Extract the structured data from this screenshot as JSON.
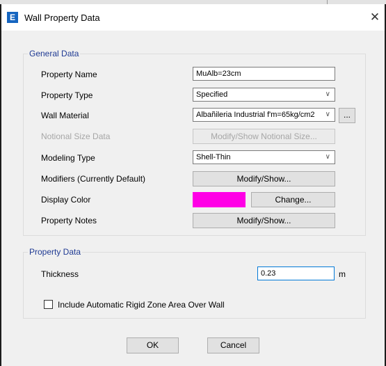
{
  "window": {
    "title": "Wall Property Data",
    "app_icon": "E",
    "close_glyph": "✕"
  },
  "general_data": {
    "title": "General Data",
    "property_name": {
      "label": "Property Name",
      "value": "MuAlb=23cm"
    },
    "property_type": {
      "label": "Property Type",
      "value": "Specified"
    },
    "wall_material": {
      "label": "Wall Material",
      "value": "Albañileria Industrial f'm=65kg/cm2",
      "more_button": "..."
    },
    "notional_size": {
      "label": "Notional Size Data",
      "button": "Modify/Show Notional Size..."
    },
    "modeling_type": {
      "label": "Modeling Type",
      "value": "Shell-Thin"
    },
    "modifiers": {
      "label": "Modifiers (Currently Default)",
      "button": "Modify/Show..."
    },
    "display_color": {
      "label": "Display Color",
      "color": "#ff00e6",
      "button": "Change..."
    },
    "property_notes": {
      "label": "Property Notes",
      "button": "Modify/Show..."
    }
  },
  "property_data": {
    "title": "Property Data",
    "thickness": {
      "label": "Thickness",
      "value": "0.23",
      "unit": "m"
    },
    "rigid_zone": {
      "label": "Include Automatic Rigid Zone Area Over Wall",
      "checked": false
    }
  },
  "footer": {
    "ok": "OK",
    "cancel": "Cancel"
  }
}
